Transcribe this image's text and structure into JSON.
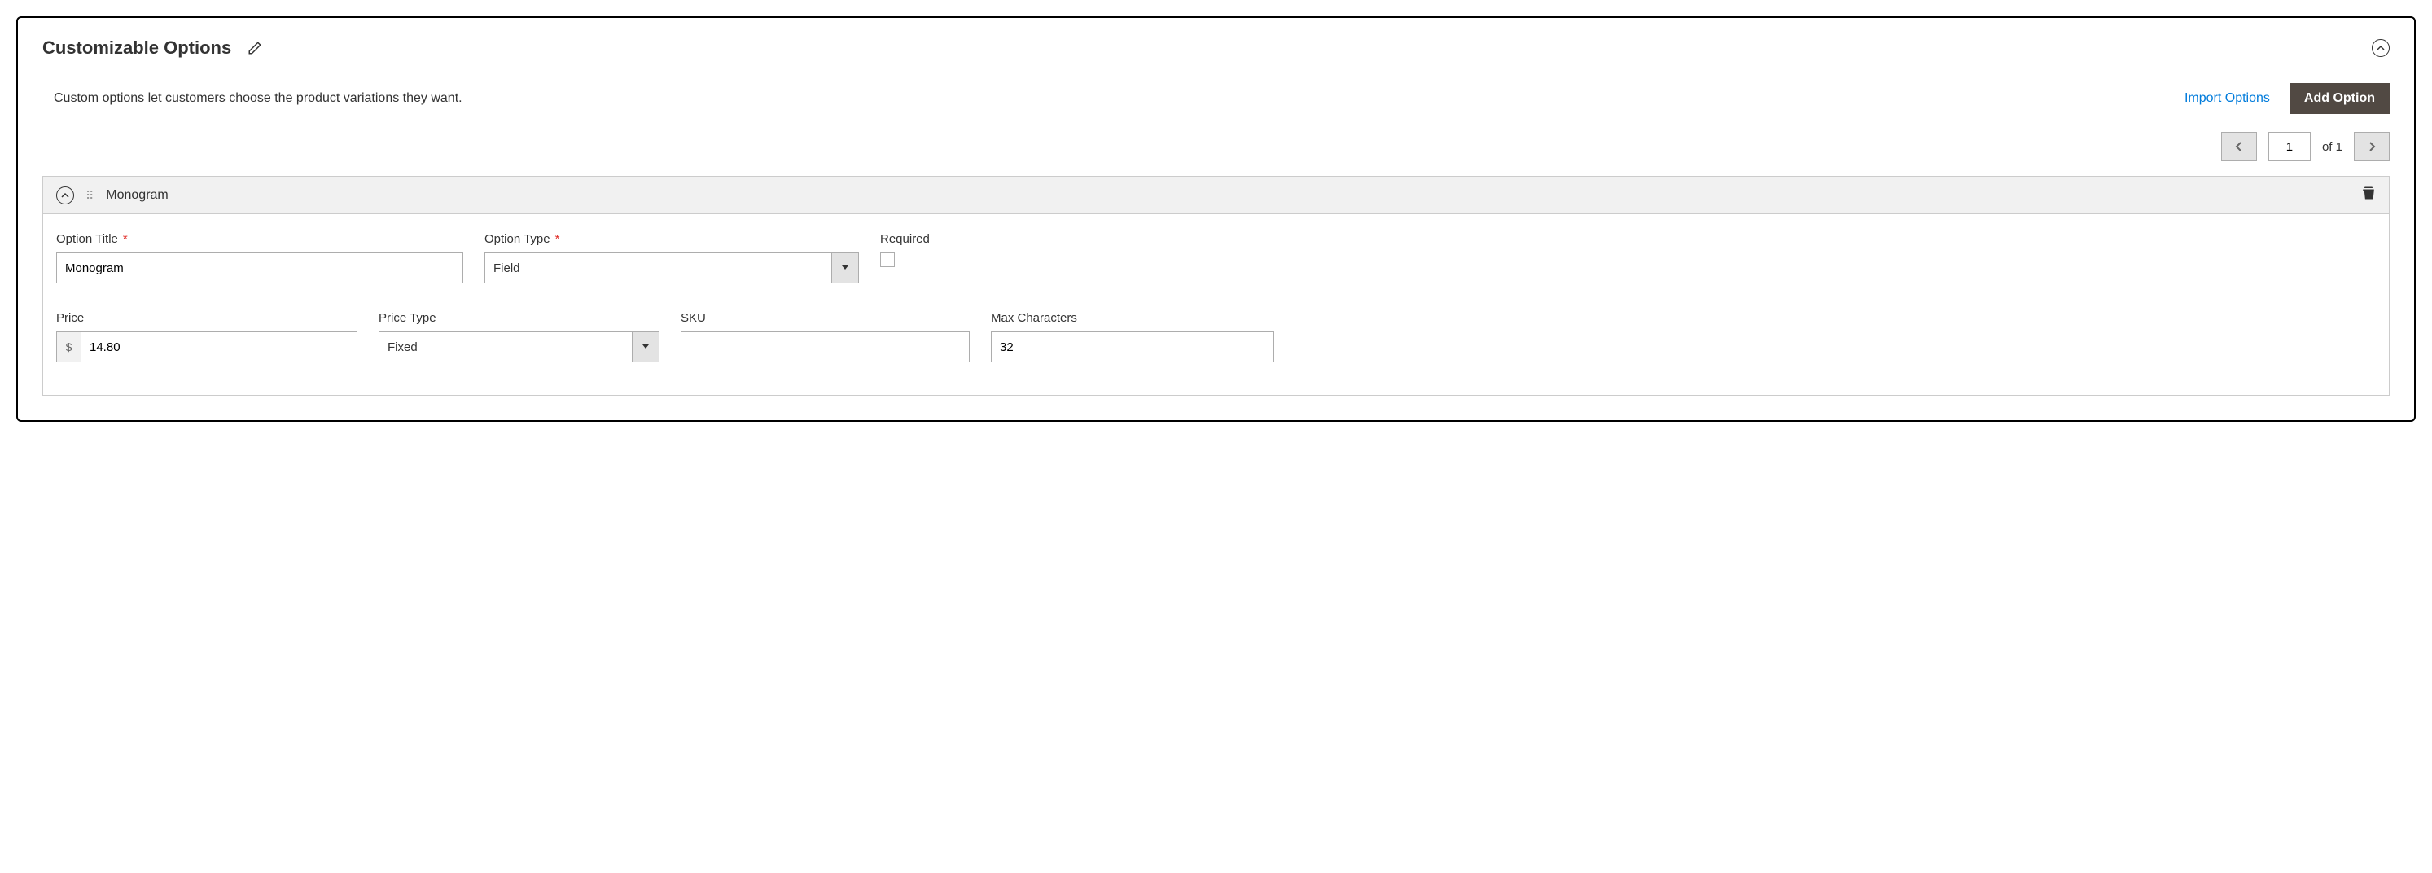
{
  "section": {
    "title": "Customizable Options",
    "description": "Custom options let customers choose the product variations they want."
  },
  "actions": {
    "import_label": "Import Options",
    "add_label": "Add Option"
  },
  "pagination": {
    "current": "1",
    "of_label": "of",
    "total": "1"
  },
  "option": {
    "name": "Monogram",
    "labels": {
      "option_title": "Option Title",
      "option_type": "Option Type",
      "required": "Required",
      "price": "Price",
      "price_type": "Price Type",
      "sku": "SKU",
      "max_chars": "Max Characters"
    },
    "values": {
      "option_title": "Monogram",
      "option_type": "Field",
      "required": false,
      "currency": "$",
      "price": "14.80",
      "price_type": "Fixed",
      "sku": "",
      "max_chars": "32"
    }
  }
}
